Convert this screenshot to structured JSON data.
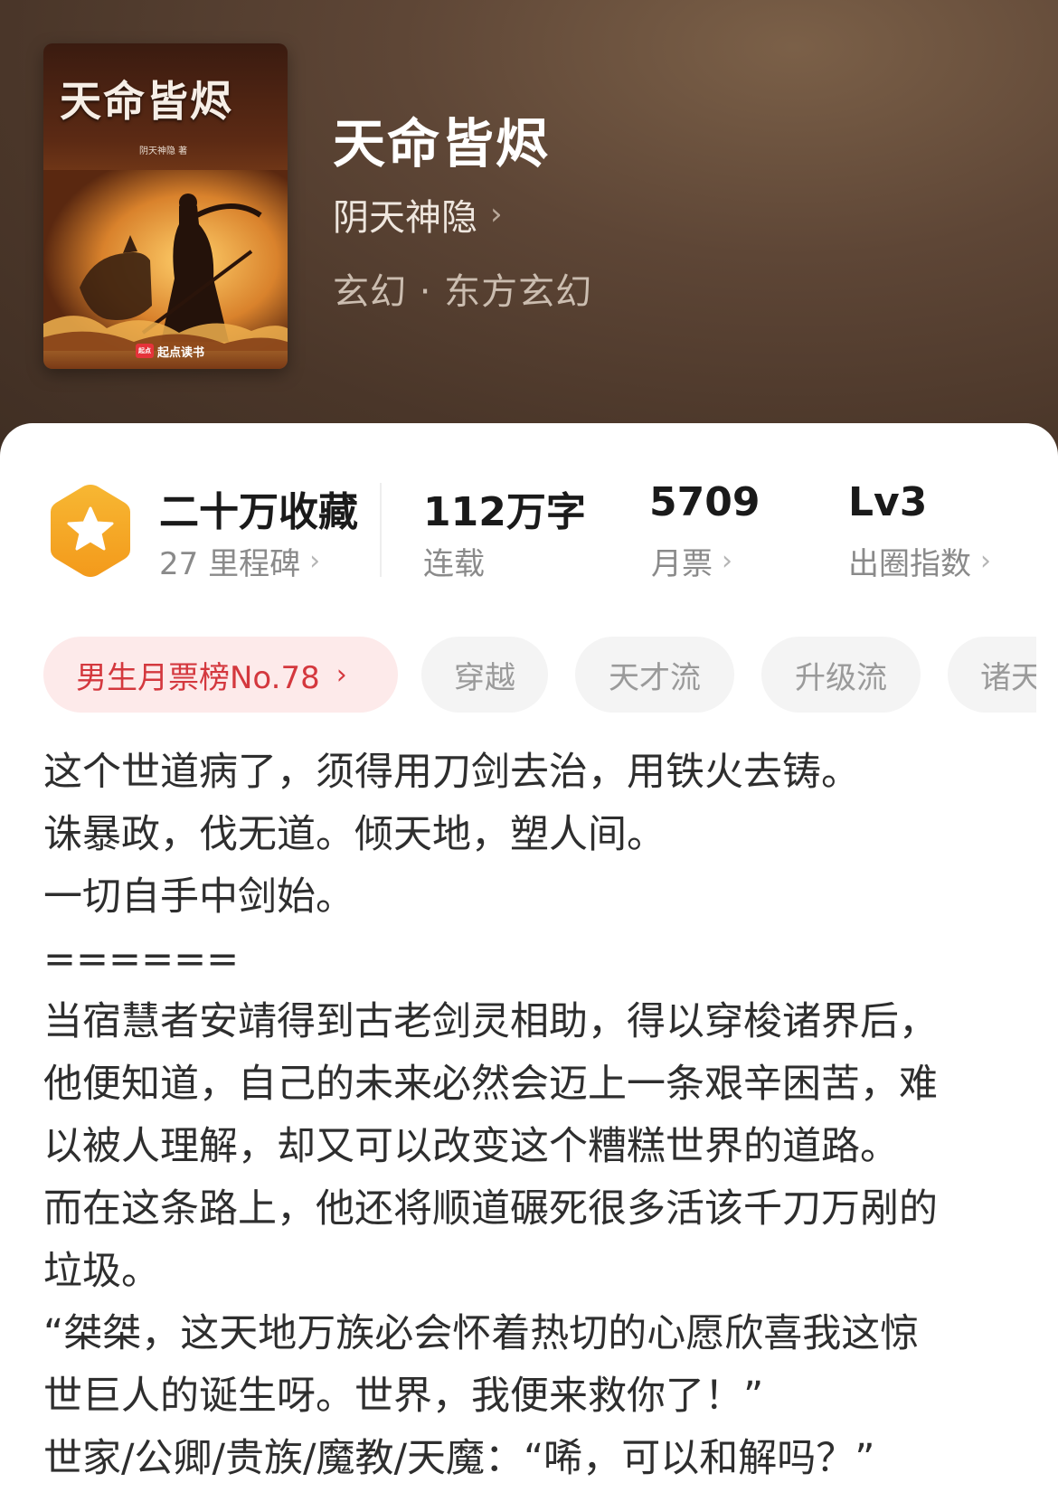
{
  "book": {
    "title": "天命皆烬",
    "author": "阴天神隐",
    "genre": "玄幻 · 东方玄幻",
    "cover": {
      "title": "天命皆烬",
      "author_credit": "阴天神隐 著",
      "brand": "起点读书",
      "brand_logo": "起点"
    }
  },
  "stats": {
    "favorites": {
      "value": "二十万收藏",
      "sub": "27 里程碑"
    },
    "words": {
      "value": "112万字",
      "sub": "连载"
    },
    "monthly_tickets": {
      "value": "5709",
      "sub": "月票"
    },
    "influence": {
      "value": "Lv3",
      "sub": "出圈指数"
    }
  },
  "tags": {
    "rank": "男生月票榜No.78",
    "items": [
      "穿越",
      "天才流",
      "升级流",
      "诸天"
    ]
  },
  "description": [
    "这个世道病了，须得用刀剑去治，用铁火去铸。",
    "诛暴政，伐无道。倾天地，塑人间。",
    "一切自手中剑始。",
    "======",
    "当宿慧者安靖得到古老剑灵相助，得以穿梭诸界后，",
    "他便知道，自己的未来必然会迈上一条艰辛困苦，难",
    "以被人理解，却又可以改变这个糟糕世界的道路。",
    "而在这条路上，他还将顺道碾死很多活该千刀万剐的",
    "垃圾。",
    "“桀桀，这天地万族必会怀着热切的心愿欣喜我这惊",
    "世巨人的诞生呀。世界，我便来救你了！”",
    "世家/公卿/贵族/魔教/天魔：“唏，可以和解吗？”"
  ],
  "colors": {
    "header_bg": "#4a3629",
    "rank_tag_bg": "#fdeaea",
    "rank_tag_text": "#d4383e",
    "badge_orange": "#f5a623"
  },
  "icons": {
    "chevron": "chevron-right-icon",
    "badge": "star-hexagon-icon"
  }
}
